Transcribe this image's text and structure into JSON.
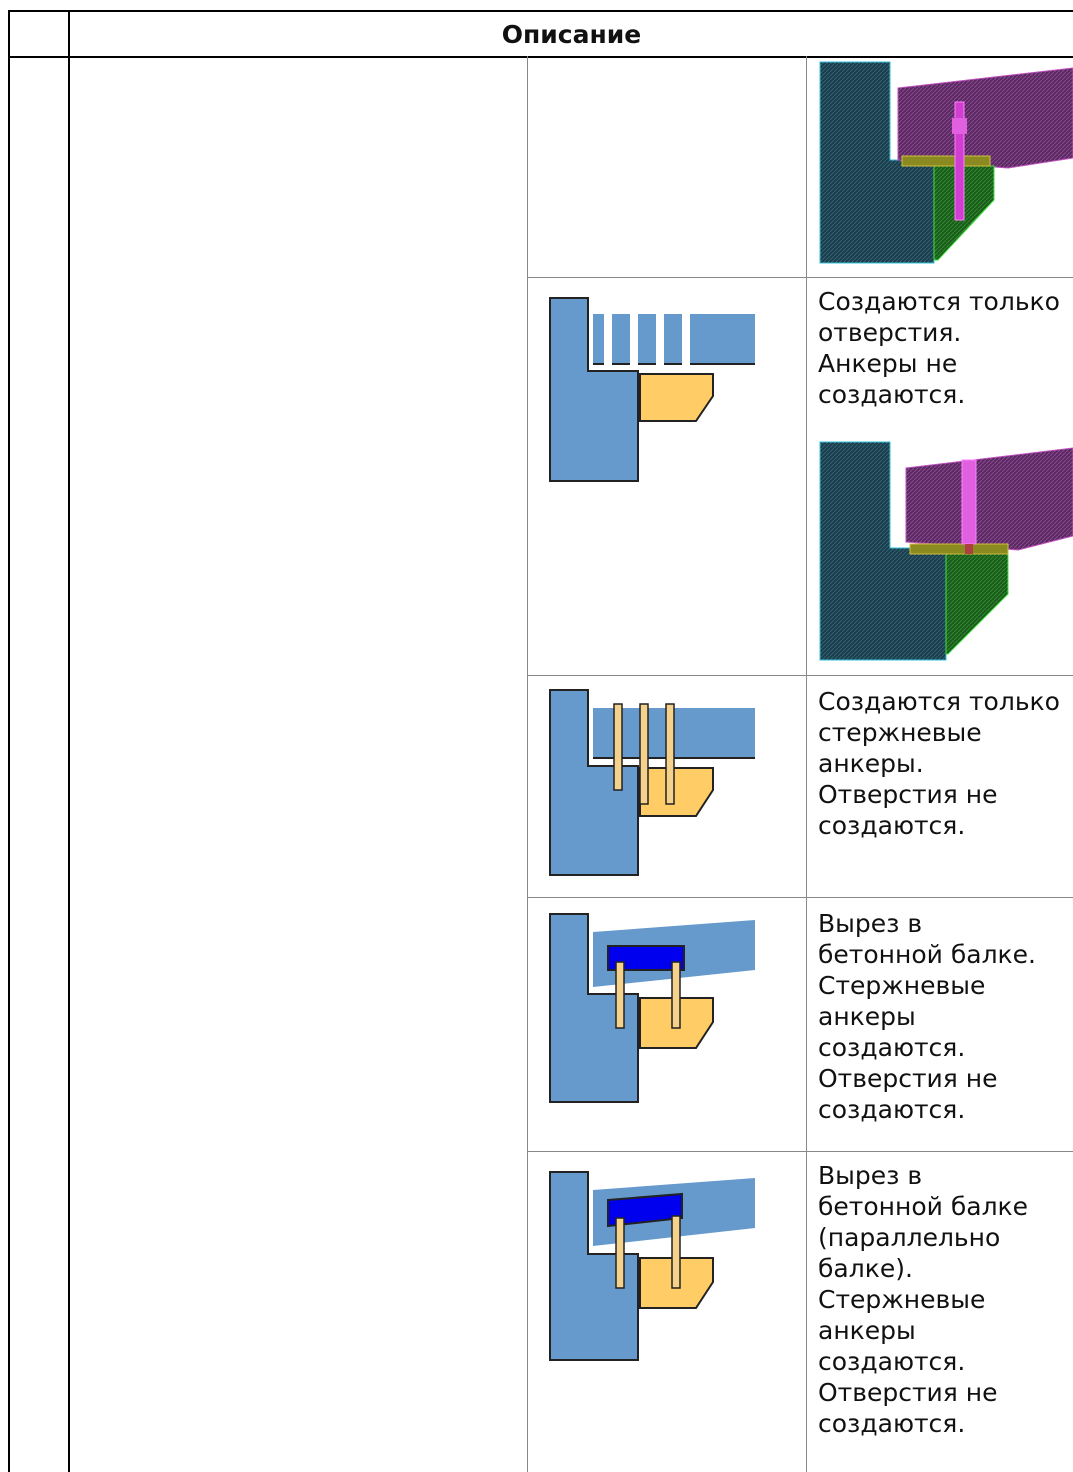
{
  "table": {
    "header": {
      "description": "Описание"
    },
    "rows": [
      {
        "text": ""
      },
      {
        "text": "Создаются только\nотверстия.\nАнкеры не\nсоздаются."
      },
      {
        "text": "Создаются только\nстержневые\nанкеры.\nОтверстия не\nсоздаются."
      },
      {
        "text": "Вырез в\nбетонной балке.\nСтержневые\nанкеры\nсоздаются.\nОтверстия не\nсоздаются."
      },
      {
        "text": "Вырез в\nбетонной балке\n(параллельно\nбалке).\nСтержневые\nанкеры\nсоздаются.\nОтверстия не\nсоздаются."
      }
    ]
  }
}
